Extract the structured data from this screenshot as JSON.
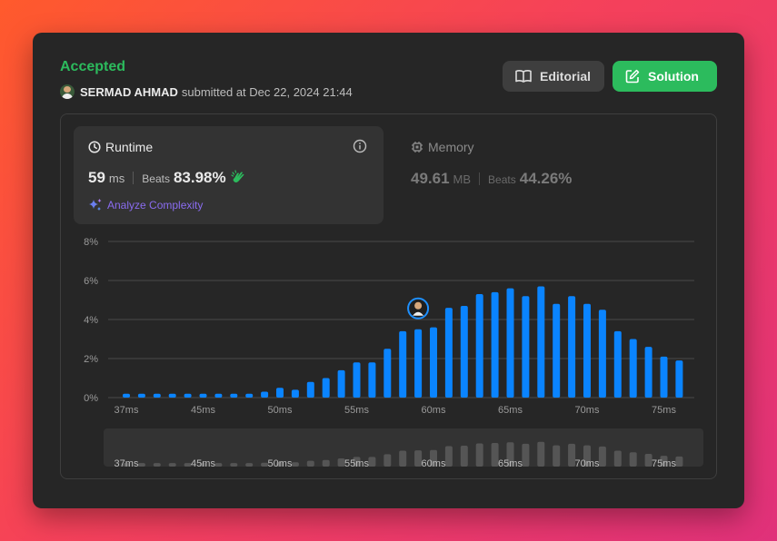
{
  "header": {
    "status": "Accepted",
    "user_name": "SERMAD AHMAD",
    "submitted_text": "submitted at Dec 22, 2024 21:44"
  },
  "buttons": {
    "editorial": "Editorial",
    "solution": "Solution"
  },
  "runtime": {
    "title": "Runtime",
    "value": "59",
    "unit": "ms",
    "beats_label": "Beats",
    "beats_value": "83.98%",
    "analyze_label": "Analyze Complexity"
  },
  "memory": {
    "title": "Memory",
    "value": "49.61",
    "unit": "MB",
    "beats_label": "Beats",
    "beats_value": "44.26%"
  },
  "colors": {
    "accent_green": "#2cbb5d",
    "bar_blue": "#0a84ff",
    "analyze_purple": "#8a6cf0"
  },
  "chart_data": {
    "type": "bar",
    "title": "",
    "xlabel": "",
    "ylabel": "",
    "ylim": [
      0,
      8
    ],
    "yticks": [
      "0%",
      "2%",
      "4%",
      "6%",
      "8%"
    ],
    "xtick_labels": [
      "37ms",
      "45ms",
      "50ms",
      "55ms",
      "60ms",
      "65ms",
      "70ms",
      "75ms"
    ],
    "xtick_indices": [
      0,
      5,
      10,
      15,
      20,
      25,
      30,
      35
    ],
    "values": [
      0.2,
      0.2,
      0.2,
      0.2,
      0.2,
      0.2,
      0.2,
      0.2,
      0.2,
      0.3,
      0.5,
      0.4,
      0.8,
      1.0,
      1.4,
      1.8,
      1.8,
      2.5,
      3.4,
      3.5,
      3.6,
      4.6,
      4.7,
      5.3,
      5.4,
      5.6,
      5.2,
      5.7,
      4.8,
      5.2,
      4.8,
      4.5,
      3.4,
      3.0,
      2.6,
      2.1,
      1.9
    ],
    "highlight_index": 19,
    "grid": true,
    "overview_values": [
      0.2,
      0.2,
      0.2,
      0.2,
      0.2,
      0.2,
      0.2,
      0.2,
      0.2,
      0.3,
      0.5,
      0.4,
      0.8,
      1.0,
      1.4,
      1.8,
      1.8,
      2.5,
      3.4,
      3.5,
      3.6,
      4.6,
      4.7,
      5.3,
      5.4,
      5.6,
      5.2,
      5.7,
      4.8,
      5.2,
      4.8,
      4.5,
      3.4,
      3.0,
      2.6,
      2.1,
      1.9
    ]
  }
}
